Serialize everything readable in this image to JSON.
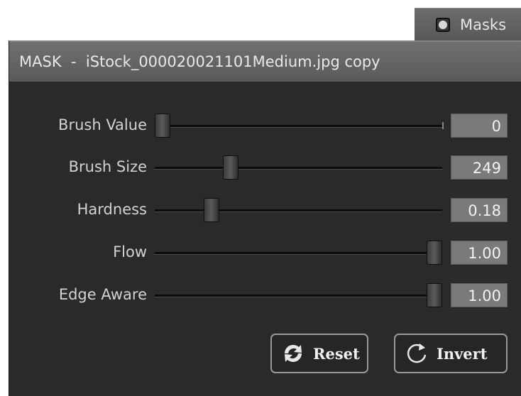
{
  "tab": {
    "label": "Masks",
    "icon": "mask-icon"
  },
  "panel": {
    "title": "MASK  -  iStock_000020021101Medium.jpg copy"
  },
  "sliders": [
    {
      "label": "Brush Value",
      "value": "0",
      "position": 0.0
    },
    {
      "label": "Brush Size",
      "value": "249",
      "position": 0.25
    },
    {
      "label": "Hardness",
      "value": "0.18",
      "position": 0.18
    },
    {
      "label": "Flow",
      "value": "1.00",
      "position": 1.0
    },
    {
      "label": "Edge Aware",
      "value": "1.00",
      "position": 1.0
    }
  ],
  "buttons": {
    "reset": {
      "label": "Reset",
      "icon": "refresh-arrows-icon"
    },
    "invert": {
      "label": "Invert",
      "icon": "rotate-icon"
    }
  },
  "colors": {
    "panel_bg": "#2a2a2a",
    "value_box": "#7a7a7a",
    "titlebar": "#656565"
  }
}
